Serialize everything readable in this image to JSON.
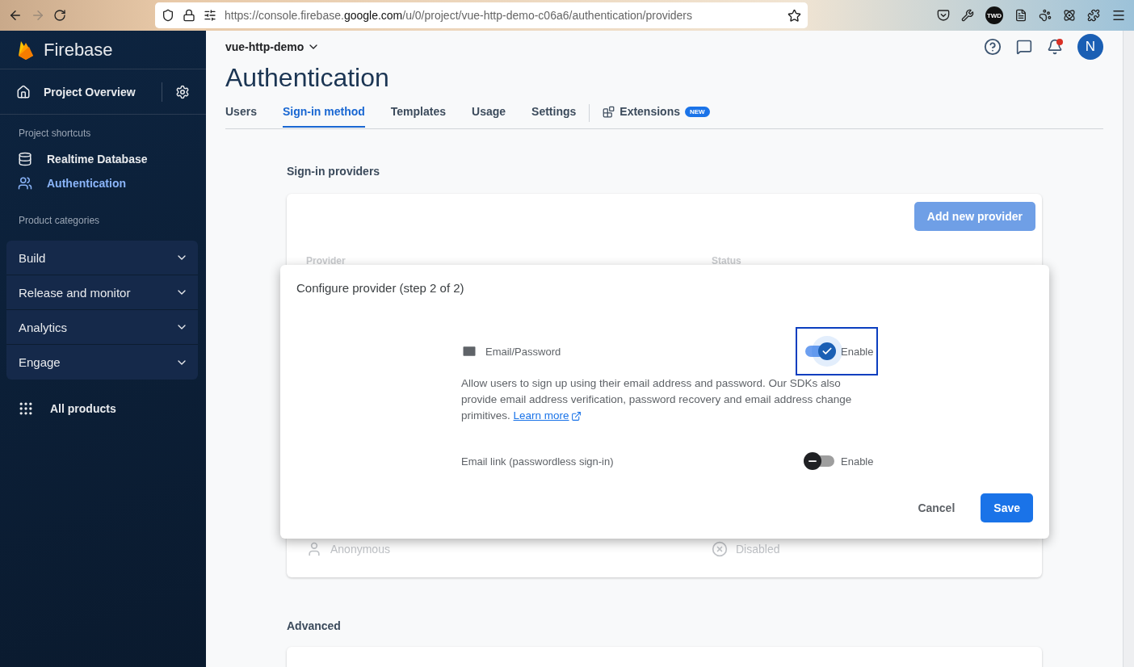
{
  "browser": {
    "url": "https://console.firebase.**google.com**/u/0/project/vue-http-demo-c06a6/authentication/providers",
    "forward_disabled": true,
    "extension_badge": "TWD"
  },
  "sidebar": {
    "brand": "Firebase",
    "overview": "Project Overview",
    "sections": [
      {
        "heading": "Project shortcuts",
        "items": [
          {
            "label": "Realtime Database",
            "selected": false
          },
          {
            "label": "Authentication",
            "selected": true
          }
        ]
      }
    ],
    "categories_heading": "Product categories",
    "categories": [
      {
        "label": "Build",
        "expanded": false
      },
      {
        "label": "Release and monitor",
        "expanded": false
      },
      {
        "label": "Analytics",
        "expanded": false
      },
      {
        "label": "Engage",
        "expanded": false
      }
    ],
    "all_products": "All products"
  },
  "header": {
    "project": "vue-http-demo",
    "avatar": "N",
    "notification_dot": true
  },
  "page_title": "Authentication",
  "tabs": [
    {
      "label": "Users",
      "selected": false
    },
    {
      "label": "Sign-in method",
      "selected": true
    },
    {
      "label": "Templates",
      "selected": false
    },
    {
      "label": "Usage",
      "selected": false
    },
    {
      "label": "Settings",
      "selected": false
    },
    {
      "label": "Extensions",
      "selected": false,
      "badge": "NEW"
    }
  ],
  "providers": {
    "heading": "Sign-in providers",
    "add_button": "Add new provider",
    "columns": [
      "Provider",
      "Status"
    ],
    "rows": [
      {
        "name": "Anonymous",
        "status": "Disabled"
      }
    ]
  },
  "dialog": {
    "title": "Configure provider (step 2 of 2)",
    "options": [
      {
        "label": "Email/Password",
        "icon": true,
        "toggle_label": "Enable",
        "on": true,
        "focused": true,
        "description": "Allow users to sign up using their email address and password. Our SDKs also provide email address verification, password recovery and email address change primitives.",
        "link": "Learn more"
      },
      {
        "label": "Email link (passwordless sign-in)",
        "icon": false,
        "toggle_label": "Enable",
        "on": false,
        "focused": false
      }
    ],
    "buttons": [
      {
        "label": "Cancel",
        "kind": "text"
      },
      {
        "label": "Save",
        "kind": "primary"
      }
    ]
  },
  "advanced_heading": "Advanced"
}
